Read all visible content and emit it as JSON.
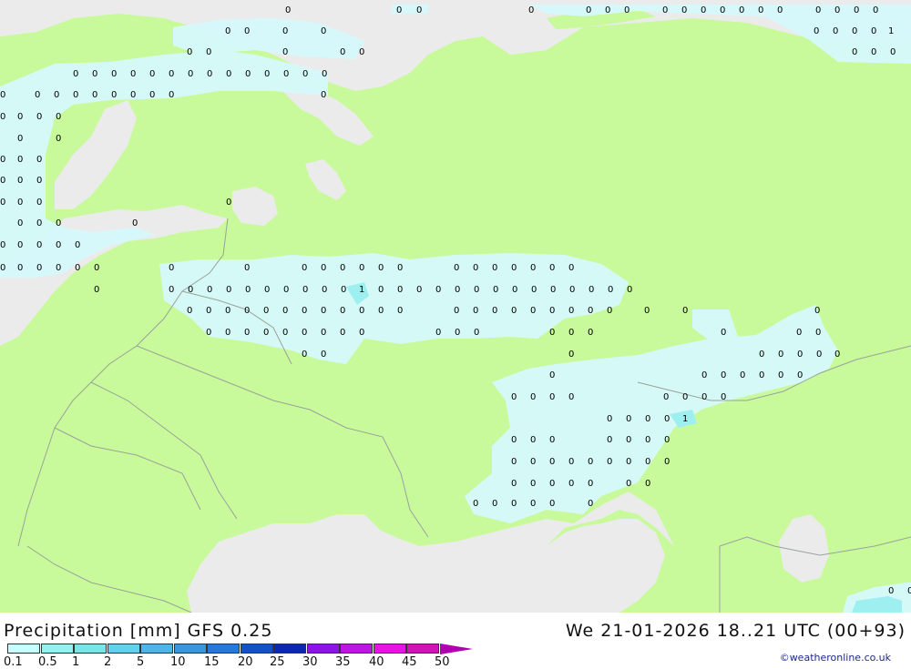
{
  "header": {
    "title": "Precipitation [mm] GFS 0.25",
    "datetime": "We 21-01-2026 18..21 UTC (00+93)",
    "credit": "©weatheronline.co.uk"
  },
  "legend": {
    "ticks": [
      "0.1",
      "0.5",
      "1",
      "2",
      "5",
      "10",
      "15",
      "20",
      "25",
      "30",
      "35",
      "40",
      "45",
      "50"
    ],
    "colors": [
      "#c8ffff",
      "#96f0f0",
      "#78e6e6",
      "#64d2e6",
      "#50b4e6",
      "#3c96dc",
      "#2878dc",
      "#1450c8",
      "#0a28b4",
      "#8c14e6",
      "#be14e6",
      "#e614e6",
      "#d214b4",
      "#b000b0"
    ]
  },
  "colors": {
    "land": "#c8fa9b",
    "sea": "#ebebeb",
    "precip_light": "#d6f9fc",
    "precip_medium": "#9eeff0",
    "borders": "#9aa29a"
  },
  "map": {
    "value_labels": {
      "zero": "0",
      "one": "1"
    }
  }
}
